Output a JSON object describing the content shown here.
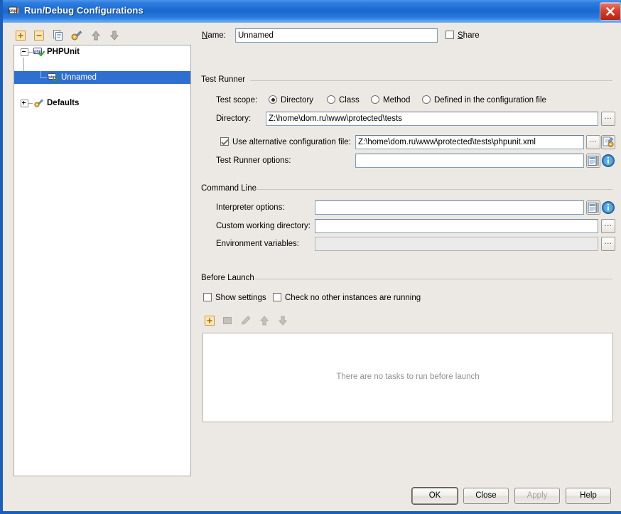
{
  "window": {
    "title": "Run/Debug Configurations",
    "app_icon": "php-icon",
    "close_label": "×",
    "title_bar_color": "#1867cf",
    "dialog_bg": "#ece9e4"
  },
  "left_toolbar": {
    "buttons": [
      {
        "name": "add-configuration-button",
        "icon": "plus-icon",
        "enabled": true
      },
      {
        "name": "remove-configuration-button",
        "icon": "minus-icon",
        "enabled": true
      },
      {
        "name": "copy-configuration-button",
        "icon": "copy-icon",
        "enabled": true
      },
      {
        "name": "edit-defaults-button",
        "icon": "wrench-icon",
        "enabled": true
      },
      {
        "name": "move-up-button",
        "icon": "arrow-up-icon",
        "enabled": true
      },
      {
        "name": "move-down-button",
        "icon": "arrow-down-icon",
        "enabled": true
      }
    ]
  },
  "tree": {
    "nodes": [
      {
        "label": "PHPUnit",
        "icon": "phpunit-icon",
        "expanded": true,
        "level": 0,
        "selected": false,
        "bold": true
      },
      {
        "label": "Unnamed",
        "icon": "phpunit-icon",
        "expanded": null,
        "level": 1,
        "selected": true,
        "bold": false
      },
      {
        "label": "Defaults",
        "icon": "wrench-icon",
        "expanded": false,
        "level": 0,
        "selected": false,
        "bold": true
      }
    ],
    "selection_color": "#2f6fd0"
  },
  "name_row": {
    "label": "Name:",
    "value": "Unnamed",
    "placeholder": "",
    "share_label": "Share",
    "share_checked": false
  },
  "test_runner": {
    "group_title": "Test Runner",
    "test_scope_label": "Test scope:",
    "scope_options": [
      {
        "label": "Directory",
        "selected": true
      },
      {
        "label": "Class",
        "selected": false
      },
      {
        "label": "Method",
        "selected": false
      },
      {
        "label": "Defined in the configuration file",
        "selected": false
      }
    ],
    "directory_label": "Directory:",
    "directory_value": "Z:\\home\\dom.ru\\www\\protected\\tests",
    "directory_browse": "...",
    "alt_config_label": "Use alternative configuration file:",
    "alt_config_checked": true,
    "alt_config_value": "Z:\\home\\dom.ru\\www\\protected\\tests\\phpunit.xml",
    "alt_config_browse": "...",
    "alt_config_edit_icon": "edit-configuration-icon",
    "options_label": "Test Runner options:",
    "options_value": "",
    "options_macro_icon": "expand-macro-icon",
    "options_info_icon": "info-icon"
  },
  "command_line": {
    "group_title": "Command Line",
    "interpreter_label": "Interpreter options:",
    "interpreter_value": "",
    "interpreter_macro_icon": "expand-macro-icon",
    "interpreter_info_icon": "info-icon",
    "working_dir_label": "Custom working directory:",
    "working_dir_value": "",
    "working_dir_browse": "...",
    "env_label": "Environment variables:",
    "env_value": "",
    "env_disabled": true,
    "env_browse": "..."
  },
  "before_launch": {
    "group_title": "Before Launch",
    "show_settings_label": "Show settings",
    "show_settings_checked": false,
    "check_instances_label": "Check no other instances are running",
    "check_instances_checked": false,
    "toolbar": [
      {
        "name": "add-task-button",
        "icon": "plus-icon",
        "enabled": true
      },
      {
        "name": "remove-task-button",
        "icon": "minus-square-icon",
        "enabled": false
      },
      {
        "name": "edit-task-button",
        "icon": "pencil-icon",
        "enabled": false
      },
      {
        "name": "task-move-up-button",
        "icon": "arrow-up-icon",
        "enabled": false
      },
      {
        "name": "task-move-down-button",
        "icon": "arrow-down-icon",
        "enabled": false
      }
    ],
    "empty_text": "There are no tasks to run before launch"
  },
  "footer": {
    "buttons": [
      {
        "label": "OK",
        "name": "ok-button",
        "enabled": true,
        "default": true
      },
      {
        "label": "Close",
        "name": "close-button",
        "enabled": true,
        "default": false
      },
      {
        "label": "Apply",
        "name": "apply-button",
        "enabled": false,
        "default": false
      },
      {
        "label": "Help",
        "name": "help-button",
        "enabled": true,
        "default": false
      }
    ]
  }
}
